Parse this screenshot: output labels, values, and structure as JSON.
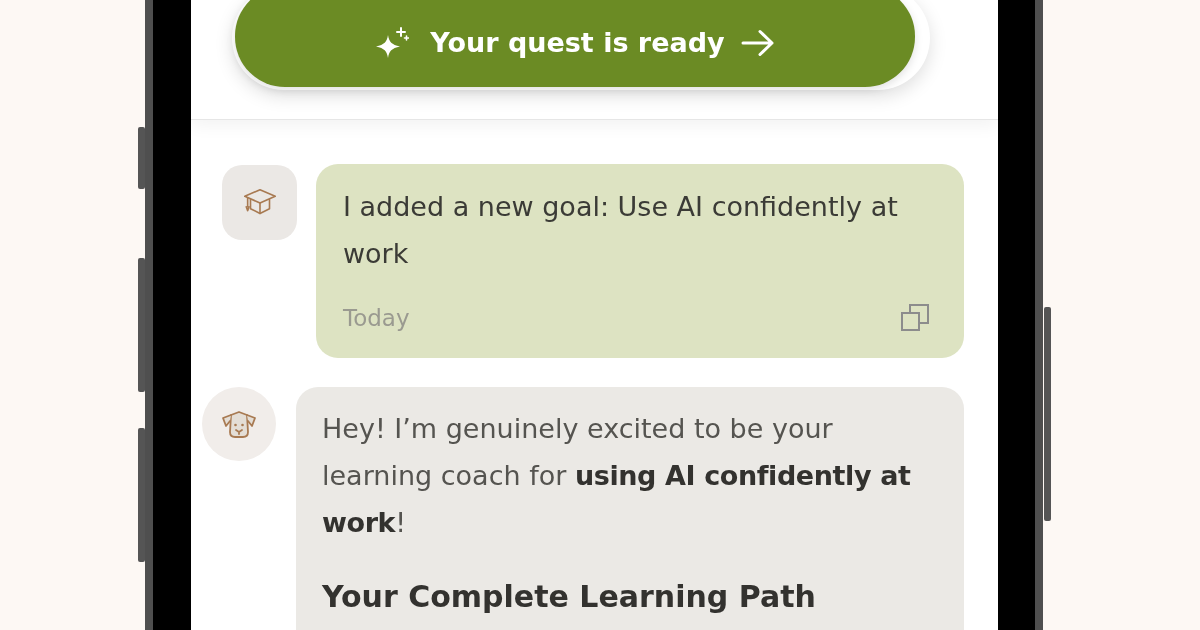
{
  "quest_button": {
    "label": "Your quest is ready"
  },
  "messages": [
    {
      "kind": "user",
      "body": [
        {
          "kind": "paragraph",
          "text": "I added a new goal: Use AI confidently at work"
        }
      ],
      "time": "Today"
    },
    {
      "kind": "coach",
      "body": [
        {
          "kind": "paragraph",
          "text": "Hey! I’m genuinely excited to be your learning coach for **using AI confidently at work**!"
        },
        {
          "kind": "heading",
          "text": "Your Complete Learning Path"
        }
      ]
    }
  ]
}
